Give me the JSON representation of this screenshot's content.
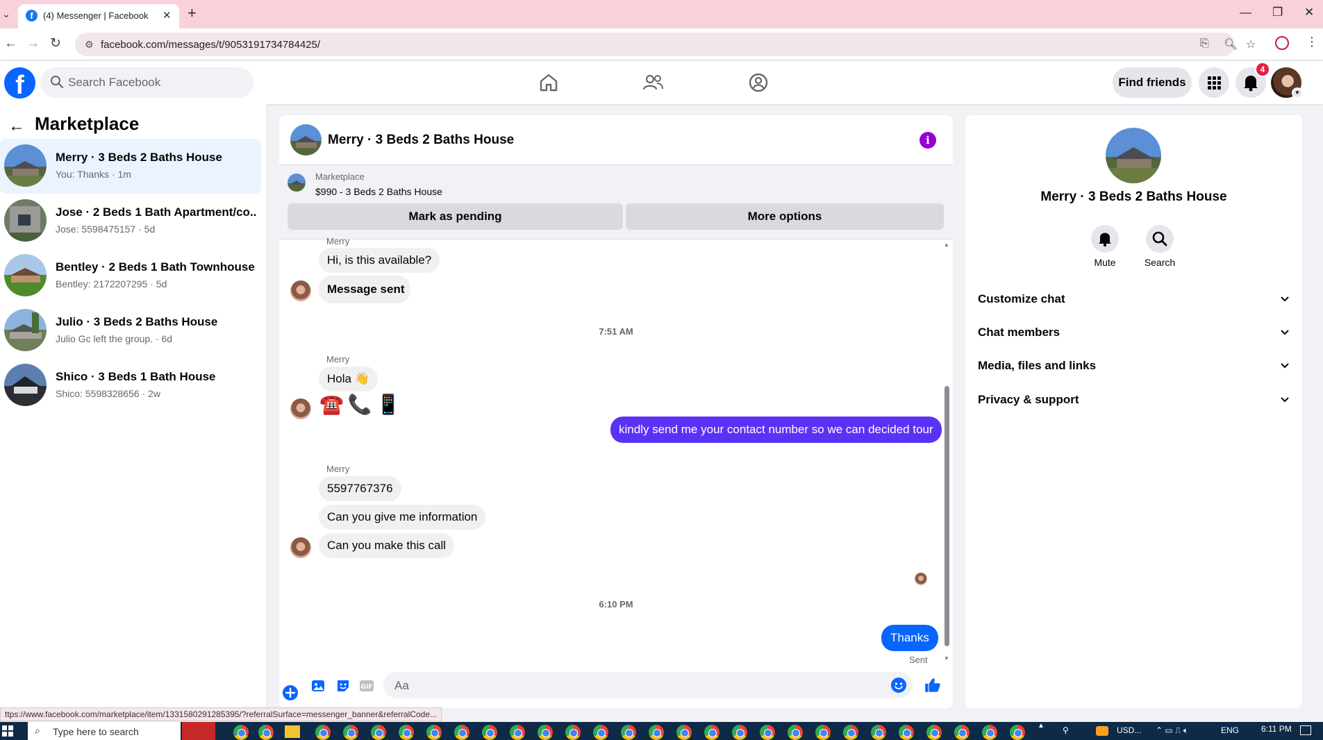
{
  "browser": {
    "tab_title": "(4) Messenger | Facebook",
    "url": "facebook.com/messages/t/9053191734784425/",
    "status_url": "ttps://www.facebook.com/marketplace/item/1331580291285395/?referralSurface=messenger_banner&referralCode..."
  },
  "fb_nav": {
    "search_placeholder": "Search Facebook",
    "find_friends": "Find friends",
    "notification_count": "4"
  },
  "sidebar": {
    "title": "Marketplace",
    "conversations": [
      {
        "name": "Merry · 3 Beds 2 Baths House",
        "snippet": "You: Thanks · 1m",
        "active": true
      },
      {
        "name": "Jose · 2 Beds 1 Bath Apartment/co...",
        "snippet": "Jose: 5598475157 · 5d",
        "active": false
      },
      {
        "name": "Bentley · 2 Beds 1 Bath Townhouse",
        "snippet": "Bentley: 2172207295 · 5d",
        "active": false
      },
      {
        "name": "Julio · 3 Beds 2 Baths House",
        "snippet": "Julio Gc left the group. · 6d",
        "active": false
      },
      {
        "name": "Shico · 3 Beds 1 Bath House",
        "snippet": "Shico: 5598328656 · 2w",
        "active": false
      }
    ]
  },
  "chat": {
    "title": "Merry · 3 Beds 2 Baths House",
    "banner": {
      "label": "Marketplace",
      "listing": "$990 - 3 Beds 2 Baths House",
      "mark_pending": "Mark as pending",
      "more_options": "More options"
    },
    "messages": {
      "sender_top": "Merry",
      "m1": "Hi, is this available?",
      "m2": "Message sent",
      "time1": "7:51 AM",
      "sender2": "Merry",
      "m3": "Hola 👋",
      "emojis": "☎️📞📱",
      "out1": "kindly send me your contact number so we can decided tour",
      "sender3": "Merry",
      "m4": "5597767376",
      "m5": "Can you give me information",
      "m6": "Can you make this call",
      "time2": "6:10 PM",
      "out2": "Thanks",
      "sent_status": "Sent"
    },
    "composer_placeholder": "Aa"
  },
  "info_panel": {
    "name": "Merry · 3 Beds 2 Baths House",
    "mute_label": "Mute",
    "search_label": "Search",
    "rows": [
      "Customize chat",
      "Chat members",
      "Media, files and links",
      "Privacy & support"
    ]
  },
  "taskbar": {
    "search_placeholder": "Type here to search",
    "tray_currency": "USD...",
    "tray_lang": "ENG",
    "tray_time": "6:11 PM"
  },
  "colors": {
    "fb_blue": "#0866ff",
    "outgoing_purple": "#5b32f5",
    "info_purple": "#9400d3",
    "active_conv_bg": "#ebf3ff",
    "tab_strip": "#f9d1da"
  }
}
